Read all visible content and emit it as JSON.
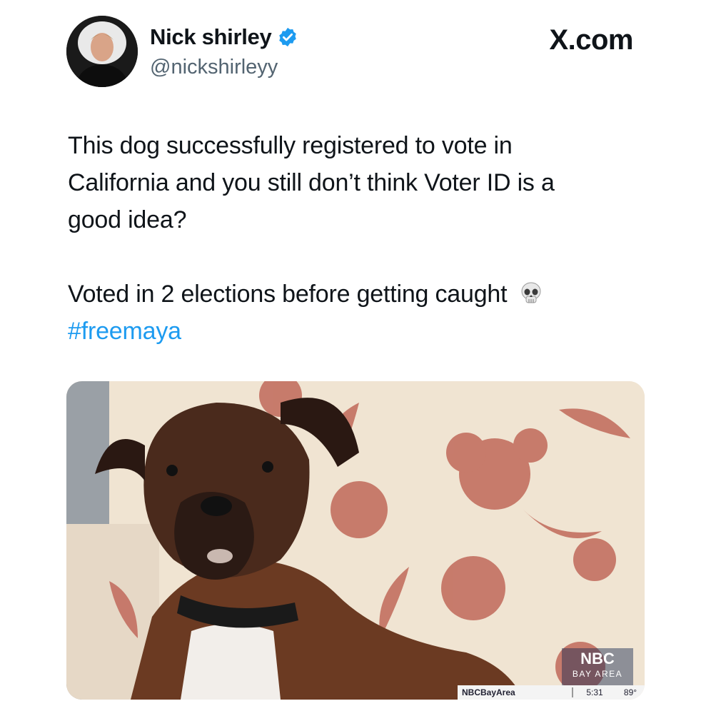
{
  "header": {
    "display_name": "Nick shirley",
    "handle": "@nickshirleyy",
    "site": "X.com",
    "verified": true,
    "verified_color": "#1d9bf0"
  },
  "tweet": {
    "line1": "This dog successfully registered to vote in",
    "line2": "California and you still don’t think Voter ID is a",
    "line3": "good idea?",
    "line4": "Voted in 2 elections before getting caught",
    "hashtag": "#freemaya",
    "hashtag_color": "#1d9bf0",
    "emoji": "skull-icon"
  },
  "media": {
    "nbc_logo": "NBC",
    "nbc_sub": "BAY AREA",
    "ticker_handle": "NBCBayArea",
    "ticker_time": "5:31",
    "ticker_temp": "89°"
  }
}
